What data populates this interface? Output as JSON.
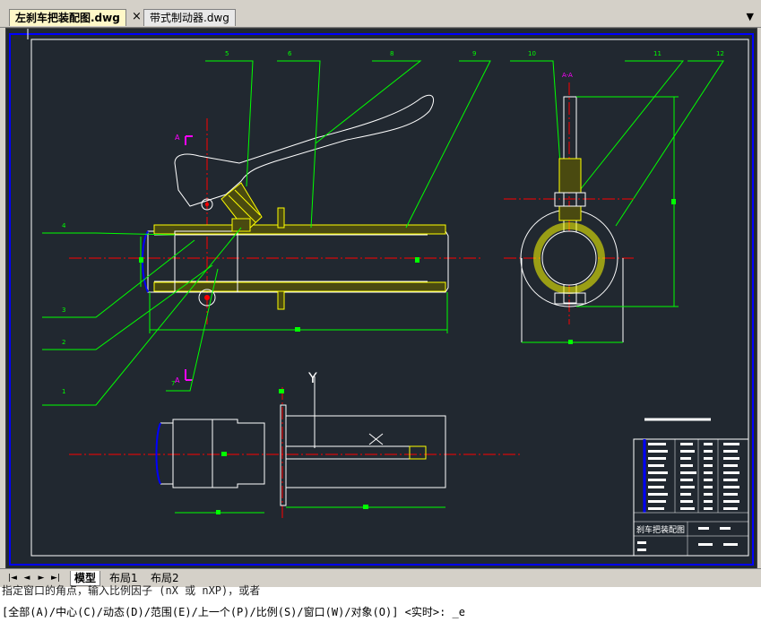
{
  "tabs": [
    {
      "label": "左刹车把装配图.dwg",
      "active": true
    },
    {
      "label": "带式制动器.dwg",
      "active": false
    }
  ],
  "tab_close_glyph": "×",
  "tab_menu_glyph": "▼",
  "layout_tabs": [
    "模型",
    "布局1",
    "布局2"
  ],
  "nav_glyphs": [
    "|◄",
    "◄",
    "►",
    "►|"
  ],
  "drawing": {
    "section_mark": "A-A",
    "title_block_label": "刹车把装配图",
    "leader_labels": {
      "l5": "5",
      "l6": "6",
      "l8": "8",
      "l9": "9",
      "l10": "10",
      "l11": "11",
      "l12": "12",
      "l4": "4",
      "l3": "3",
      "l2": "2",
      "l1": "1",
      "l7": "7"
    },
    "section_letter_top": "A",
    "section_letter_bottom": "A",
    "axis_label": "Y",
    "colors": {
      "background": "#212830",
      "outline": "#ffffff",
      "dimension": "#00ff00",
      "centerline": "#ff0000",
      "hatch": "#ffff00",
      "frame": "#0000ff",
      "section_mark": "#ff00ff"
    }
  },
  "command": {
    "line1": "指定窗口的角点，输入比例因子 (nX 或 nXP)，或者",
    "line2": "[全部(A)/中心(C)/动态(D)/范围(E)/上一个(P)/比例(S)/窗口(W)/对象(O)] <实时>: _e"
  }
}
